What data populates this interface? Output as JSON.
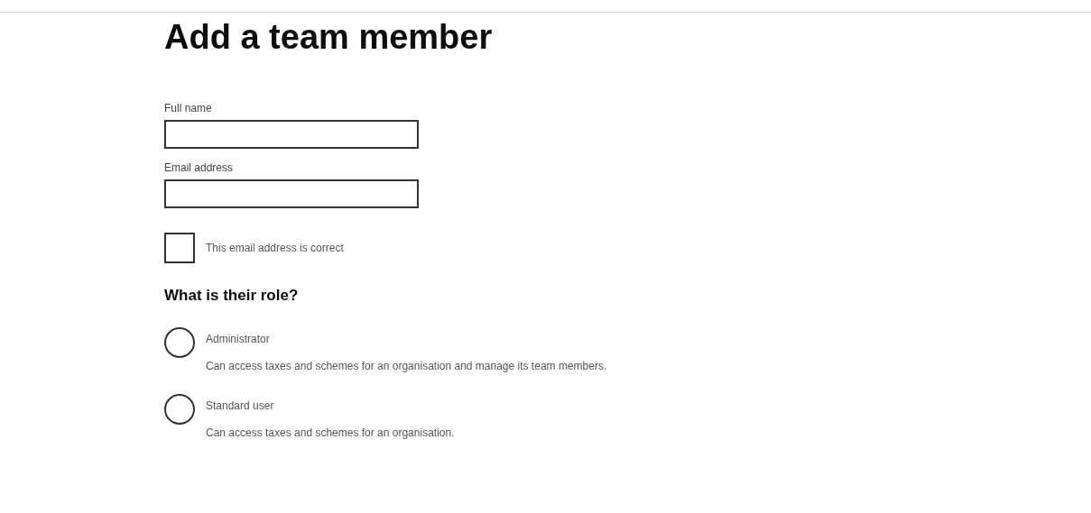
{
  "title": "Add a team member",
  "fields": [
    {
      "label": "Full name"
    },
    {
      "label": "Email address"
    }
  ],
  "confirm": {
    "label": "This email address is correct",
    "checked": false
  },
  "role": {
    "legend": "What is their role?",
    "options": [
      {
        "label": "Administrator",
        "hint": "Can access taxes and schemes for an organisation and manage its team members.",
        "selected": false
      },
      {
        "label": "Standard user",
        "hint": "Can access taxes and schemes for an organisation.",
        "selected": false
      }
    ]
  }
}
